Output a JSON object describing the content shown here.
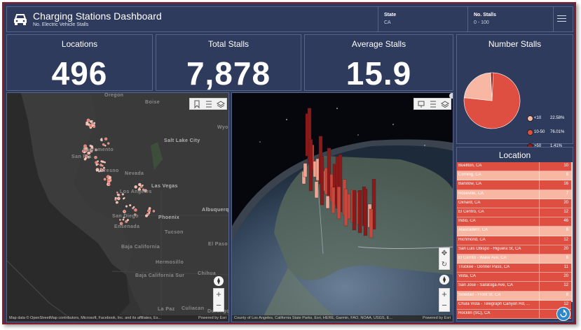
{
  "header": {
    "title": "Charging Stations Dashboard",
    "subtitle": "No. Electric Vehicle Stalls",
    "filters": [
      {
        "label": "State",
        "value": "CA"
      },
      {
        "label": "No. Stalls",
        "value": "0 - 100"
      }
    ],
    "icons": {
      "logo": "car-icon",
      "menu": "hamburger-menu-icon"
    }
  },
  "kpis": [
    {
      "title": "Locations",
      "value": "496"
    },
    {
      "title": "Total Stalls",
      "value": "7,878"
    },
    {
      "title": "Average Stalls",
      "value": "15.9"
    }
  ],
  "map2d": {
    "labels": [
      "Oregon",
      "Boise",
      "Wyomi",
      "Salt Lake City",
      "San Fra",
      "Sacramento",
      "Fresno",
      "Nevada",
      "Las Vegas",
      "Los Angeles",
      "San Diego",
      "Ensenada",
      "Phoenix",
      "Albuquerque",
      "Tucson",
      "El Paso",
      "Baja California",
      "Hermosillo",
      "Chihua",
      "Baja California Sur",
      "La Paz",
      "Culiacan",
      "Durango"
    ],
    "attribution": "Map data © OpenStreetMap contributors, Microsoft, Facebook, Inc. and its affiliates, Es...",
    "powered": "Powered by Esri",
    "zoom_in": "+",
    "zoom_out": "−"
  },
  "map3d": {
    "attribution": "County of Los Angeles, California State Parks, Esri, HERE, Garmin, FAO, NOAA, USGS, E...",
    "powered": "Powered by Esri",
    "zoom_in": "+",
    "zoom_out": "−"
  },
  "pie": {
    "title": "Number Stalls",
    "legend": [
      {
        "label": "<10",
        "pct": "22.58%",
        "color": "#f7b7a3"
      },
      {
        "label": "10-50",
        "pct": "76.01%",
        "color": "#de4f41"
      },
      {
        "label": ">50",
        "pct": "1.41%",
        "color": "#8b1a1a"
      }
    ]
  },
  "location": {
    "title": "Location",
    "rows": [
      {
        "name": "Buellton, CA",
        "value": "10",
        "color": "#de4f41"
      },
      {
        "name": "Corning, CA",
        "value": "8",
        "color": "#f7b7a3"
      },
      {
        "name": "Barstow, CA",
        "value": "16",
        "color": "#de4f41"
      },
      {
        "name": "Roseville, CA",
        "value": "7",
        "color": "#f7b7a3"
      },
      {
        "name": "Oxnard, CA",
        "value": "20",
        "color": "#de4f41"
      },
      {
        "name": "El Centro, CA",
        "value": "12",
        "color": "#de4f41"
      },
      {
        "name": "Indio, CA",
        "value": "46",
        "color": "#de4f41"
      },
      {
        "name": "Atascadero, CA",
        "value": "8",
        "color": "#f7b7a3"
      },
      {
        "name": "Richmond, CA",
        "value": "12",
        "color": "#de4f41"
      },
      {
        "name": "San Luis Obispo - Higuera St, CA",
        "value": "20",
        "color": "#de4f41"
      },
      {
        "name": "El Cerrito - Wake Ave, CA",
        "value": "8",
        "color": "#f7b7a3"
      },
      {
        "name": "Truckee - Donner Pass, CA",
        "value": "11",
        "color": "#de4f41"
      },
      {
        "name": "Vista, CA",
        "value": "20",
        "color": "#de4f41"
      },
      {
        "name": "San Jose - Saratoga Ave, CA",
        "value": "12",
        "color": "#de4f41"
      },
      {
        "name": "Soledad - Front St, CA",
        "value": "8",
        "color": "#f7b7a3"
      },
      {
        "name": "Chula Vista - Telegraph Canyon Rd, ...",
        "value": "12",
        "color": "#de4f41"
      },
      {
        "name": "Rocklin (SC), CA",
        "value": "6",
        "color": "#de4f41"
      }
    ]
  },
  "chart_data": {
    "type": "pie",
    "categories": [
      "<10",
      "10-50",
      ">50"
    ],
    "values": [
      22.58,
      76.01,
      1.41
    ],
    "colors": [
      "#f7b7a3",
      "#de4f41",
      "#8b1a1a"
    ],
    "title": "Number Stalls",
    "legend": "right"
  }
}
